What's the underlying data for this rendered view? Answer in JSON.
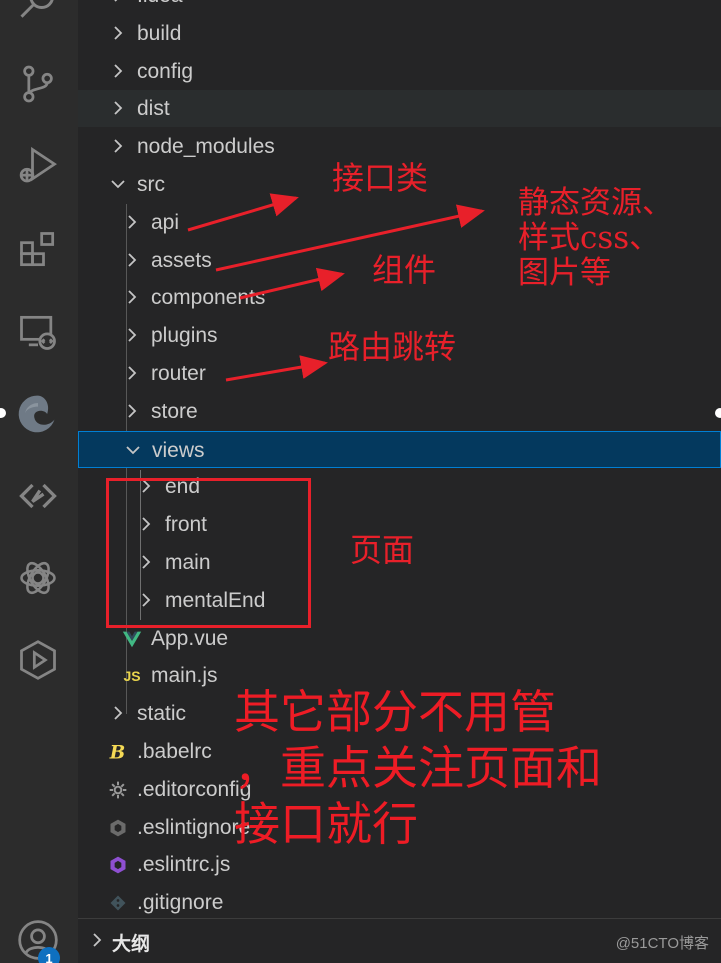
{
  "explorer": {
    "items": [
      {
        "label": ".idea",
        "kind": "folder",
        "depth": 1,
        "expanded": false
      },
      {
        "label": "build",
        "kind": "folder",
        "depth": 1,
        "expanded": false
      },
      {
        "label": "config",
        "kind": "folder",
        "depth": 1,
        "expanded": false
      },
      {
        "label": "dist",
        "kind": "folder",
        "depth": 1,
        "expanded": false
      },
      {
        "label": "node_modules",
        "kind": "folder",
        "depth": 1,
        "expanded": false
      },
      {
        "label": "src",
        "kind": "folder",
        "depth": 1,
        "expanded": true
      },
      {
        "label": "api",
        "kind": "folder",
        "depth": 2,
        "expanded": false
      },
      {
        "label": "assets",
        "kind": "folder",
        "depth": 2,
        "expanded": false
      },
      {
        "label": "components",
        "kind": "folder",
        "depth": 2,
        "expanded": false
      },
      {
        "label": "plugins",
        "kind": "folder",
        "depth": 2,
        "expanded": false
      },
      {
        "label": "router",
        "kind": "folder",
        "depth": 2,
        "expanded": false
      },
      {
        "label": "store",
        "kind": "folder",
        "depth": 2,
        "expanded": false
      },
      {
        "label": "views",
        "kind": "folder",
        "depth": 2,
        "expanded": true,
        "selected": true
      },
      {
        "label": "end",
        "kind": "folder",
        "depth": 3,
        "expanded": false
      },
      {
        "label": "front",
        "kind": "folder",
        "depth": 3,
        "expanded": false
      },
      {
        "label": "main",
        "kind": "folder",
        "depth": 3,
        "expanded": false
      },
      {
        "label": "mentalEnd",
        "kind": "folder",
        "depth": 3,
        "expanded": false
      },
      {
        "label": "App.vue",
        "kind": "vue",
        "depth": 2
      },
      {
        "label": "main.js",
        "kind": "js",
        "depth": 2
      },
      {
        "label": "static",
        "kind": "folder",
        "depth": 1,
        "expanded": false
      },
      {
        "label": ".babelrc",
        "kind": "babel",
        "depth": 1
      },
      {
        "label": ".editorconfig",
        "kind": "gear",
        "depth": 1
      },
      {
        "label": ".eslintignore",
        "kind": "eslint-ignore",
        "depth": 1
      },
      {
        "label": ".eslintrc.js",
        "kind": "eslint",
        "depth": 1
      },
      {
        "label": ".gitignore",
        "kind": "git",
        "depth": 1
      }
    ],
    "js_icon_text": "JS"
  },
  "outline": {
    "label": "大纲"
  },
  "activity_bar": {
    "icons": [
      "search-icon",
      "source-control-icon",
      "run-debug-icon",
      "extensions-icon",
      "remote-explorer-icon",
      "edge-icon",
      "live-share-icon",
      "openai-icon",
      "player-icon",
      "account-icon"
    ],
    "badge": "1"
  },
  "annotations": {
    "api": "接口类",
    "assets_line1": "静态资源、",
    "assets_line2": "样式css、",
    "assets_line3": "图片等",
    "components": "组件",
    "router": "路由跳转",
    "views": "页面",
    "note_line1": "其它部分不用管",
    "note_line2": "，重点关注页面和",
    "note_line3": "接口就行"
  },
  "watermark": "@51CTO博客",
  "colors": {
    "annotation": "#e8202a",
    "selection": "#04395e",
    "selection_border": "#007fd4",
    "badge": "#0e70c0"
  }
}
